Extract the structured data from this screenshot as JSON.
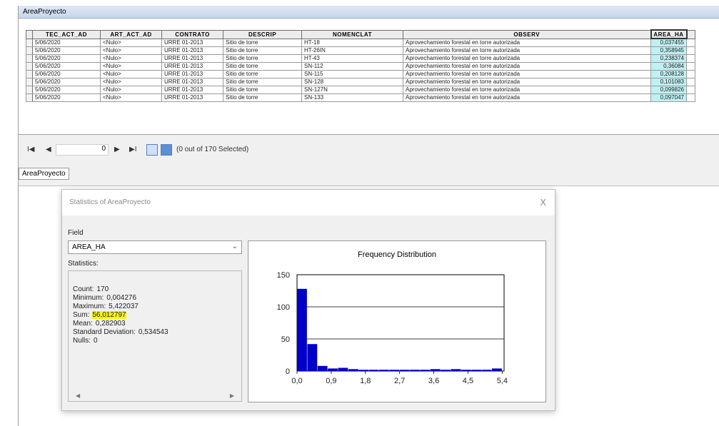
{
  "window": {
    "title": "AreaProyecto"
  },
  "table": {
    "columns": [
      "TEC_ACT_AD",
      "ART_ACT_AD",
      "CONTRATO",
      "DESCRIP",
      "NOMENCLAT",
      "OBSERV",
      "AREA_HA"
    ],
    "rows": [
      [
        "5/06/2020",
        "<Nulo>",
        "URRE 01-2013",
        "Sitio de torre",
        "HT-18",
        "Aprovechamiento forestal en torre autorizada",
        "0,037455"
      ],
      [
        "5/06/2020",
        "<Nulo>",
        "URRE 01-2013",
        "Sitio de torre",
        "HT-26IN",
        "Aprovechamiento forestal en torre autorizada",
        "0,358945"
      ],
      [
        "5/06/2020",
        "<Nulo>",
        "URRE 01-2013",
        "Sitio de torre",
        "HT-43",
        "Aprovechamiento forestal en torre autorizada",
        "0,238374"
      ],
      [
        "5/06/2020",
        "<Nulo>",
        "URRE 01-2013",
        "Sitio de torre",
        "SN-112",
        "Aprovechamiento forestal en torre autorizada",
        "0,36084"
      ],
      [
        "5/06/2020",
        "<Nulo>",
        "URRE 01-2013",
        "Sitio de torre",
        "SN-115",
        "Aprovechamiento forestal en torre autorizada",
        "0,208128"
      ],
      [
        "5/06/2020",
        "<Nulo>",
        "URRE 01-2013",
        "Sitio de torre",
        "SN-128",
        "Aprovechamiento forestal en torre autorizada",
        "0,101083"
      ],
      [
        "5/06/2020",
        "<Nulo>",
        "URRE 01-2013",
        "Sitio de torre",
        "SN-127N",
        "Aprovechamiento forestal en torre autorizada",
        "0,099826"
      ],
      [
        "5/06/2020",
        "<Nulo>",
        "URRE 01-2013",
        "Sitio de torre",
        "SN-133",
        "Aprovechamiento forestal en torre autorizada",
        "0,097047"
      ]
    ]
  },
  "navigation": {
    "first_glyph": "I◀",
    "prev_glyph": "◀",
    "current_record": "0",
    "next_glyph": "▶",
    "last_glyph": "▶I",
    "selection_status": "(0 out of 170 Selected)"
  },
  "tab_label": "AreaProyecto",
  "dialog": {
    "title": "Statistics of AreaProyecto",
    "close_glyph": "X",
    "field_label": "Field",
    "field_value": "AREA_HA",
    "statistics_label": "Statistics:",
    "stats": [
      {
        "label": "Count:",
        "value": "170"
      },
      {
        "label": "Minimum:",
        "value": "0,004276"
      },
      {
        "label": "Maximum:",
        "value": "5,422037"
      },
      {
        "label": "Sum:",
        "value": "56,012797",
        "highlight": true
      },
      {
        "label": "Mean:",
        "value": "0,282903"
      },
      {
        "label": "Standard Deviation:",
        "value": "0,534543"
      },
      {
        "label": "Nulls:",
        "value": "0"
      }
    ],
    "highlight_color": "#f7f51a"
  },
  "chart_data": {
    "type": "bar",
    "title": "Frequency Distribution",
    "xlabel": "",
    "ylabel": "",
    "ylim": [
      0,
      150
    ],
    "xlim": [
      0,
      5.45
    ],
    "yticks": [
      0,
      50,
      100,
      150
    ],
    "xtick_values": [
      0,
      0.9,
      1.8,
      2.7,
      3.6,
      4.5,
      5.4
    ],
    "xtick_labels": [
      "0,0",
      "0,9",
      "1,8",
      "2,7",
      "3,6",
      "4,5",
      "5,4"
    ],
    "grid": true,
    "bin_width": 0.27,
    "bins": [
      0,
      0.27,
      0.54,
      0.81,
      1.08,
      1.35,
      1.62,
      1.89,
      2.16,
      2.43,
      2.7,
      2.97,
      3.24,
      3.51,
      3.78,
      4.05,
      4.32,
      4.59,
      4.86,
      5.13
    ],
    "values": [
      128,
      42,
      8,
      4,
      5,
      3,
      2,
      2,
      2,
      2,
      2,
      2,
      2,
      3,
      2,
      3,
      2,
      2,
      2,
      4
    ],
    "bar_color": "#0000c8"
  }
}
